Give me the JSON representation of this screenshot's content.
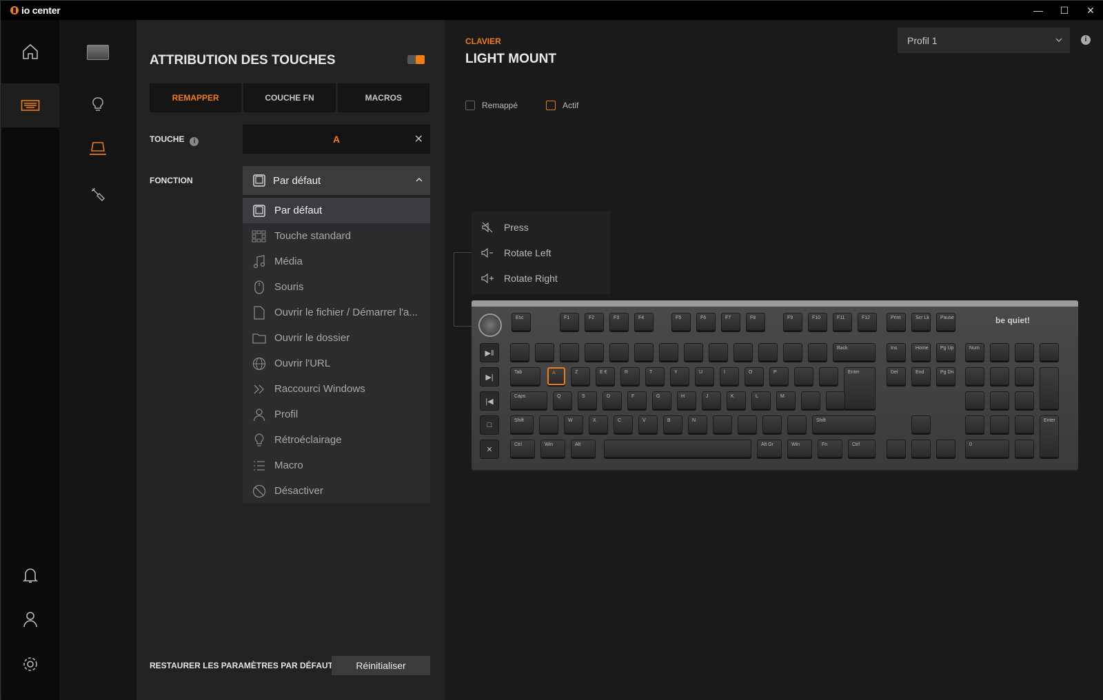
{
  "titlebar": {
    "app_name": "io center",
    "minimize": "—",
    "maximize": "☐",
    "close": "✕"
  },
  "rail": {
    "items": [
      "home-icon",
      "keyboard-icon",
      "notification-icon",
      "user-icon",
      "settings-icon"
    ]
  },
  "subrail": {
    "items": [
      "device-thumbnail",
      "lighting-icon",
      "key-assignment-icon",
      "tools-icon"
    ]
  },
  "panel": {
    "title": "ATTRIBUTION DES TOUCHES",
    "tabs": [
      {
        "label": "REMAPPER",
        "active": true
      },
      {
        "label": "COUCHE FN",
        "active": false
      },
      {
        "label": "MACROS",
        "active": false
      }
    ],
    "key_label": "TOUCHE",
    "key_info": "i",
    "key_value": "A",
    "key_clear": "✕",
    "function_label": "FONCTION",
    "function_selected": "Par défaut",
    "dropdown": [
      {
        "label": "Par défaut",
        "icon": "keycap-icon",
        "selected": true
      },
      {
        "label": "Touche standard",
        "icon": "keyboard-grid-icon"
      },
      {
        "label": "Média",
        "icon": "music-note-icon"
      },
      {
        "label": "Souris",
        "icon": "mouse-icon"
      },
      {
        "label": "Ouvrir le fichier / Démarrer l'a...",
        "icon": "file-icon"
      },
      {
        "label": "Ouvrir le dossier",
        "icon": "folder-icon"
      },
      {
        "label": "Ouvrir l'URL",
        "icon": "globe-icon"
      },
      {
        "label": "Raccourci Windows",
        "icon": "double-chevron-icon"
      },
      {
        "label": "Profil",
        "icon": "person-icon"
      },
      {
        "label": "Rétroéclairage",
        "icon": "bulb-icon"
      },
      {
        "label": "Macro",
        "icon": "list-icon"
      },
      {
        "label": "Désactiver",
        "icon": "block-icon"
      }
    ],
    "reset_label": "RESTAURER LES PARAMÈTRES PAR DÉFAUT",
    "reset_button": "Réinitialiser"
  },
  "main": {
    "breadcrumb": "CLAVIER",
    "device_title": "LIGHT MOUNT",
    "profile_select": "Profil 1",
    "profile_info": "i",
    "legend": [
      {
        "label": "Remappé",
        "color": "#666666"
      },
      {
        "label": "Actif",
        "color": "#f07c14"
      }
    ],
    "knob_menu": [
      {
        "label": "Press",
        "icon": "mute-icon"
      },
      {
        "label": "Rotate Left",
        "icon": "volume-down-icon"
      },
      {
        "label": "Rotate Right",
        "icon": "volume-up-icon"
      }
    ],
    "keyboard_brand": "be quiet!",
    "keys": {
      "esc": "Esc",
      "f1": "F1",
      "f2": "F2",
      "f3": "F3",
      "f4": "F4",
      "f5": "F5",
      "f6": "F6",
      "f7": "F7",
      "f8": "F8",
      "f9": "F9",
      "f10": "F10",
      "f11": "F11",
      "f12": "F12",
      "print": "Print",
      "scrlk": "Scr Lk",
      "pause": "Pause",
      "back": "Back",
      "tab": "Tab",
      "a": "A",
      "z": "Z",
      "e": "E €",
      "r": "R",
      "t": "T",
      "y": "Y",
      "u": "U",
      "i": "I",
      "o": "O",
      "p": "P",
      "enter": "Enter",
      "caps": "Caps",
      "q": "Q",
      "s": "S",
      "d": "D",
      "f": "F",
      "g": "G",
      "h": "H",
      "j": "J",
      "k": "K",
      "l": "L",
      "m": "M",
      "shift": "Shift",
      "w": "W",
      "x": "X",
      "c": "C",
      "v": "V",
      "b": "B",
      "n": "N",
      "ctrl": "Ctrl",
      "win": "Win",
      "alt": "Alt",
      "altgr": "Alt Gr",
      "fn": "Fn",
      "ins": "Ins",
      "home": "Home",
      "pgup": "Pg Up",
      "del": "Del",
      "end": "End",
      "pgdn": "Pg Dn",
      "num": "Num",
      "numenter": "Enter",
      "zero": "0"
    }
  },
  "colors": {
    "accent": "#f07c14",
    "panel_bg": "#222223",
    "main_bg": "#1a1a1a"
  }
}
